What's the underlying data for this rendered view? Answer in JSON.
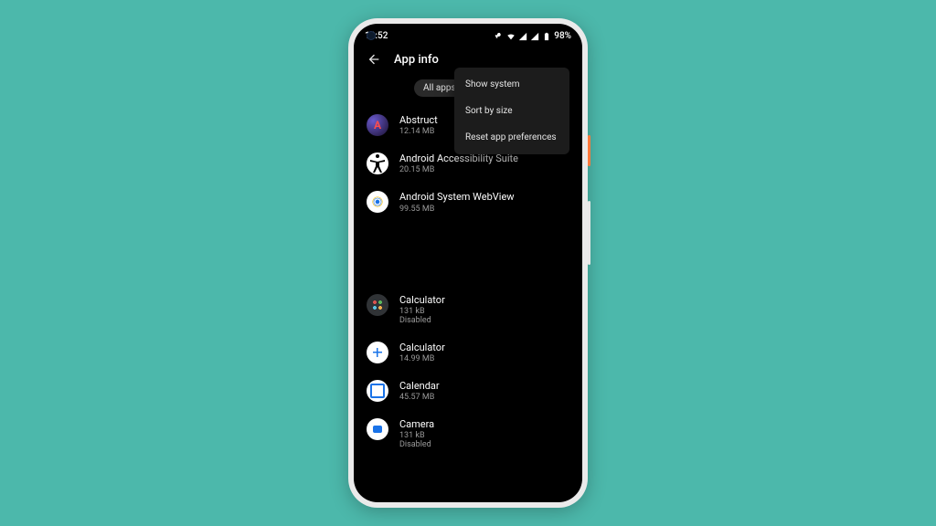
{
  "statusbar": {
    "time": "18:52",
    "battery_text": "98%"
  },
  "header": {
    "title": "App info"
  },
  "filter": {
    "label": "All apps"
  },
  "menu": {
    "items": [
      {
        "label": "Show system"
      },
      {
        "label": "Sort by size"
      },
      {
        "label": "Reset app preferences"
      }
    ]
  },
  "apps": [
    {
      "name": "Abstruct",
      "size": "12.14 MB",
      "status": "",
      "icon": "abstruct-icon",
      "gap": false
    },
    {
      "name": "Android Accessibility Suite",
      "size": "20.15 MB",
      "status": "",
      "icon": "accessibility-icon",
      "gap": false
    },
    {
      "name": "Android System WebView",
      "size": "99.55 MB",
      "status": "",
      "icon": "webview-icon",
      "gap": false
    },
    {
      "name": "Calculator",
      "size": "131 kB",
      "status": "Disabled",
      "icon": "calculator-dark-icon",
      "gap": true
    },
    {
      "name": "Calculator",
      "size": "14.99 MB",
      "status": "",
      "icon": "calculator-light-icon",
      "gap": false
    },
    {
      "name": "Calendar",
      "size": "45.57 MB",
      "status": "",
      "icon": "calendar-icon",
      "gap": false
    },
    {
      "name": "Camera",
      "size": "131 kB",
      "status": "Disabled",
      "icon": "camera-icon",
      "gap": false
    }
  ]
}
